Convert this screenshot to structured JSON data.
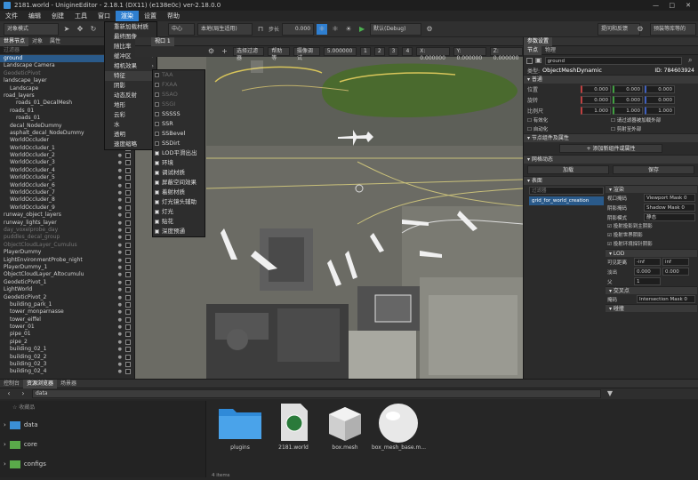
{
  "window": {
    "title": "2181.world - UnigineEditor - 2.18.1 (DX11) (e138e0c) ver-2.18.0.0"
  },
  "menu": {
    "items": [
      "文件",
      "编辑",
      "创建",
      "工具",
      "窗口",
      "渲染",
      "设置",
      "帮助"
    ],
    "active_index": 5
  },
  "toolbar": {
    "mode_select": "对象模式",
    "pivot_center": "中心",
    "coord_space": "本地(局生适用)",
    "step_label": "步长",
    "step_value": "0.000",
    "play_config": "默认(Debug)",
    "btn_feedback": "提问和反馈",
    "btn_newver": "预装等库等的"
  },
  "render_menu": {
    "items": [
      {
        "label": "重新加载材质",
        "type": "plain"
      },
      {
        "label": "最终图像",
        "type": "plain"
      },
      {
        "label": "随比率",
        "type": "plain"
      },
      {
        "label": "缓冲区",
        "type": "submenu"
      },
      {
        "label": "相机效果",
        "type": "submenu"
      },
      {
        "label": "特征",
        "type": "submenu",
        "highlighted": true
      },
      {
        "label": "阴影",
        "type": "submenu"
      },
      {
        "label": "动态反射",
        "type": "submenu"
      },
      {
        "label": "地形",
        "type": "submenu"
      },
      {
        "label": "云彩",
        "type": "submenu"
      },
      {
        "label": "水",
        "type": "submenu"
      },
      {
        "label": "透明",
        "type": "submenu"
      },
      {
        "label": "速度缩略",
        "type": "submenu"
      }
    ]
  },
  "features_menu": {
    "items": [
      {
        "label": "TAA",
        "checked": false,
        "disabled": true
      },
      {
        "label": "FXAA",
        "checked": false,
        "disabled": true
      },
      {
        "label": "SSAO",
        "checked": false,
        "disabled": true
      },
      {
        "label": "SSGI",
        "checked": false,
        "disabled": true
      },
      {
        "label": "SSSSS",
        "checked": false,
        "disabled": false
      },
      {
        "label": "SSR",
        "checked": false,
        "disabled": false
      },
      {
        "label": "SSBevel",
        "checked": false,
        "disabled": false
      },
      {
        "label": "SSDirt",
        "checked": false,
        "disabled": false
      },
      {
        "label": "LOD平滑出出",
        "checked": true,
        "disabled": false
      },
      {
        "label": "环境",
        "checked": true,
        "disabled": false
      },
      {
        "label": "调试材质",
        "checked": true,
        "disabled": false
      },
      {
        "label": "屏蔽空间效果",
        "checked": true,
        "disabled": false
      },
      {
        "label": "着射材质",
        "checked": true,
        "disabled": false
      },
      {
        "label": "灯光镜头辅助",
        "checked": true,
        "disabled": false
      },
      {
        "label": "灯光",
        "checked": true,
        "disabled": false
      },
      {
        "label": "贴花",
        "checked": true,
        "disabled": false
      },
      {
        "label": "深度预通",
        "checked": true,
        "disabled": false
      }
    ]
  },
  "outliner": {
    "tabs": [
      "世界节点",
      "对象",
      "属性"
    ],
    "filter_placeholder": "过滤器",
    "rows": [
      {
        "label": "ground",
        "indent": 0,
        "selected": true,
        "dim": false
      },
      {
        "label": "Landscape Camera",
        "indent": 0,
        "selected": false,
        "dim": false
      },
      {
        "label": "GeodeticPivot",
        "indent": 0,
        "selected": false,
        "dim": true
      },
      {
        "label": "landscape_layer",
        "indent": 0,
        "selected": false,
        "dim": false
      },
      {
        "label": "Landscape",
        "indent": 1,
        "selected": false,
        "dim": false
      },
      {
        "label": "road_layers",
        "indent": 0,
        "selected": false,
        "dim": false
      },
      {
        "label": "roads_01_DecalMesh",
        "indent": 2,
        "selected": false,
        "dim": false
      },
      {
        "label": "roads_01",
        "indent": 1,
        "selected": false,
        "dim": false
      },
      {
        "label": "roads_01",
        "indent": 2,
        "selected": false,
        "dim": false
      },
      {
        "label": "decal_NodeDummy",
        "indent": 1,
        "selected": false,
        "dim": false
      },
      {
        "label": "asphalt_decal_NodeDummy",
        "indent": 1,
        "selected": false,
        "dim": false
      },
      {
        "label": "WorldOccluder",
        "indent": 1,
        "selected": false,
        "dim": false
      },
      {
        "label": "WorldOccluder_1",
        "indent": 1,
        "selected": false,
        "dim": false
      },
      {
        "label": "WorldOccluder_2",
        "indent": 1,
        "selected": false,
        "dim": false
      },
      {
        "label": "WorldOccluder_3",
        "indent": 1,
        "selected": false,
        "dim": false
      },
      {
        "label": "WorldOccluder_4",
        "indent": 1,
        "selected": false,
        "dim": false
      },
      {
        "label": "WorldOccluder_5",
        "indent": 1,
        "selected": false,
        "dim": false
      },
      {
        "label": "WorldOccluder_6",
        "indent": 1,
        "selected": false,
        "dim": false
      },
      {
        "label": "WorldOccluder_7",
        "indent": 1,
        "selected": false,
        "dim": false
      },
      {
        "label": "WorldOccluder_8",
        "indent": 1,
        "selected": false,
        "dim": false
      },
      {
        "label": "WorldOccluder_9",
        "indent": 1,
        "selected": false,
        "dim": false
      },
      {
        "label": "runway_object_layers",
        "indent": 0,
        "selected": false,
        "dim": false
      },
      {
        "label": "runway_lights_layer",
        "indent": 0,
        "selected": false,
        "dim": false
      },
      {
        "label": "day_voxelprobe_day",
        "indent": 0,
        "selected": false,
        "dim": true
      },
      {
        "label": "puddles_decal_group",
        "indent": 0,
        "selected": false,
        "dim": true
      },
      {
        "label": "ObjectCloudLayer_Cumulus",
        "indent": 0,
        "selected": false,
        "dim": true
      },
      {
        "label": "PlayerDummy",
        "indent": 0,
        "selected": false,
        "dim": false
      },
      {
        "label": "LightEnvironmentProbe_night",
        "indent": 0,
        "selected": false,
        "dim": false
      },
      {
        "label": "PlayerDummy_1",
        "indent": 0,
        "selected": false,
        "dim": false
      },
      {
        "label": "ObjectCloudLayer_Altocumulu",
        "indent": 0,
        "selected": false,
        "dim": false
      },
      {
        "label": "GeodeticPivot_1",
        "indent": 0,
        "selected": false,
        "dim": false
      },
      {
        "label": "LightWorld",
        "indent": 0,
        "selected": false,
        "dim": false
      },
      {
        "label": "GeodeticPivot_2",
        "indent": 0,
        "selected": false,
        "dim": false
      },
      {
        "label": "building_park_1",
        "indent": 1,
        "selected": false,
        "dim": false
      },
      {
        "label": "tower_monparnasse",
        "indent": 1,
        "selected": false,
        "dim": false
      },
      {
        "label": "tower_eiffel",
        "indent": 1,
        "selected": false,
        "dim": false
      },
      {
        "label": "tower_01",
        "indent": 1,
        "selected": false,
        "dim": false
      },
      {
        "label": "pipe_01",
        "indent": 1,
        "selected": false,
        "dim": false
      },
      {
        "label": "pipe_2",
        "indent": 1,
        "selected": false,
        "dim": false
      },
      {
        "label": "building_02_1",
        "indent": 1,
        "selected": false,
        "dim": false
      },
      {
        "label": "building_02_2",
        "indent": 1,
        "selected": false,
        "dim": false
      },
      {
        "label": "building_02_3",
        "indent": 1,
        "selected": false,
        "dim": false
      },
      {
        "label": "building_02_4",
        "indent": 1,
        "selected": false,
        "dim": false
      }
    ]
  },
  "viewport": {
    "tab": "视口 1",
    "filter_label": "选择过滤器",
    "help_label": "帮助等",
    "camera_label": "摄像调试",
    "speed": "5.000000",
    "grid": [
      "1",
      "2",
      "3",
      "4"
    ],
    "x_field": "X: 0.000000",
    "y_field": "Y: 0.000000",
    "z_field": "Z: 0.000000"
  },
  "props": {
    "tabs": [
      "参数设置",
      "节点",
      "物理"
    ],
    "node_name": "ground",
    "type_label": "类型:",
    "type_value": "ObjectMeshDynamic",
    "id_value": "ID: 784603924",
    "section_general": "普通",
    "pos_label": "位置",
    "rot_label": "旋转",
    "scale_label": "比例尺",
    "pos": [
      "0.000",
      "0.000",
      "0.000"
    ],
    "rot": [
      "0.000",
      "0.000",
      "0.000"
    ],
    "scale": [
      "1.000",
      "1.000",
      "1.000"
    ],
    "check_enabled": "有效化",
    "check_handled": "请过滤器被加载外部",
    "check_immovable": "自动化",
    "check_rad": "剪射至外部",
    "section_components": "节点组件及属性",
    "add_component": "添加新组件或属性",
    "section_mesh": "网格动态",
    "btn_load": "加载",
    "btn_save": "保存",
    "section_surfaces": "表面",
    "surface_filter": "过滤器",
    "surface_name": "grid_for_world_creation",
    "sub_render": "渲染",
    "viewport_mask_lbl": "视口掩码",
    "viewport_mask_val": "Viewport Mask 0",
    "shadow_mask_lbl": "阴影掩码",
    "shadow_mask_val": "Shadow Mask 0",
    "shadow_mode_lbl": "阴影模式",
    "shadow_mode_val": "静态",
    "chk_cast_shadow": "投射投影到主阴影",
    "chk_cast_world": "投射世界阴影",
    "chk_cast_env": "投射环境探针阴影",
    "section_lod": "LOD",
    "lod_visible": "可见距离",
    "lod_visible_min": "-inf",
    "lod_visible_max": "inf",
    "lod_fade": "淡出",
    "lod_fade_a": "0.000",
    "lod_fade_b": "0.000",
    "lod_parent": "父",
    "lod_parent_val": "1",
    "section_intersect": "交叉点",
    "intersect_label": "掩码",
    "intersect_val": "Intersection Mask 0",
    "section_collide": "碰撞"
  },
  "browser": {
    "tabs": [
      "控制台",
      "资源浏览器",
      "场景器"
    ],
    "path": "data",
    "favorites": "收藏品",
    "tree": [
      "data",
      "core",
      "configs"
    ],
    "assets": [
      "plugins",
      "2181.world",
      "box.mesh",
      "box_mesh_base.m..."
    ],
    "status": "4 items"
  },
  "colors": {
    "accent": "#2f7fd0",
    "selected_row": "#2a5a8a",
    "grass": "#4a6a2e",
    "tarmac": "#6b6b64"
  }
}
